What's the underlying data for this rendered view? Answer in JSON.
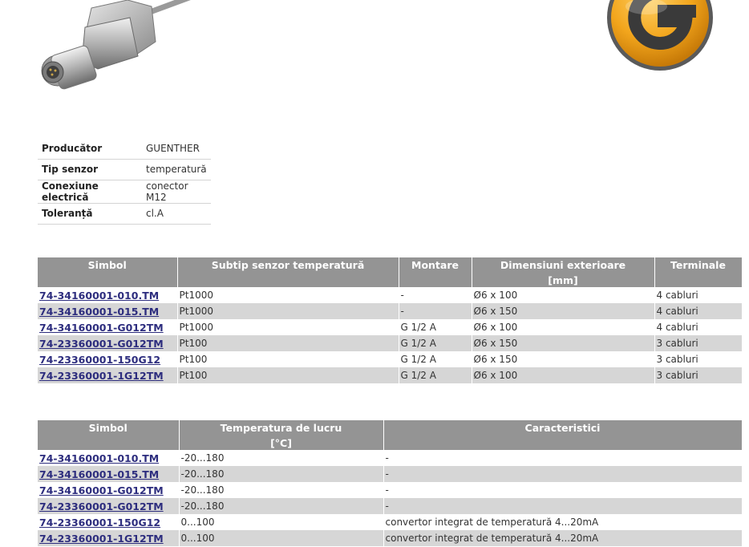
{
  "specs": [
    {
      "label": "Producător",
      "value": "GUENTHER"
    },
    {
      "label": "Tip senzor",
      "value": "temperatură"
    },
    {
      "label": "Conexiune electrică",
      "value": "conector M12"
    },
    {
      "label": "Toleranță",
      "value": "cl.A"
    }
  ],
  "table1": {
    "headers": [
      "Simbol",
      "Subtip senzor temperatură",
      "Montare",
      "Dimensiuni exterioare",
      "Terminale"
    ],
    "units": [
      "",
      "",
      "",
      "[mm]",
      ""
    ],
    "rows": [
      [
        "74-34160001-010.TM",
        "Pt1000",
        "-",
        "Ø6 x 100",
        "4 cabluri"
      ],
      [
        "74-34160001-015.TM",
        "Pt1000",
        "-",
        "Ø6 x 150",
        "4 cabluri"
      ],
      [
        "74-34160001-G012TM",
        "Pt1000",
        "G 1/2 A",
        "Ø6 x 100",
        "4 cabluri"
      ],
      [
        "74-23360001-G012TM",
        "Pt100",
        "G 1/2 A",
        "Ø6 x 150",
        "3 cabluri"
      ],
      [
        "74-23360001-150G12",
        "Pt100",
        "G 1/2 A",
        "Ø6 x 150",
        "3 cabluri"
      ],
      [
        "74-23360001-1G12TM",
        "Pt100",
        "G 1/2 A",
        "Ø6 x 100",
        "3 cabluri"
      ]
    ]
  },
  "table2": {
    "headers": [
      "Simbol",
      "Temperatura de lucru",
      "Caracteristici"
    ],
    "units": [
      "",
      "[°C]",
      ""
    ],
    "rows": [
      [
        "74-34160001-010.TM",
        "-20...180",
        "-"
      ],
      [
        "74-34160001-015.TM",
        "-20...180",
        "-"
      ],
      [
        "74-34160001-G012TM",
        "-20...180",
        "-"
      ],
      [
        "74-23360001-G012TM",
        "-20...180",
        "-"
      ],
      [
        "74-23360001-150G12",
        "0...100",
        "convertor integrat de temperatură 4...20mA"
      ],
      [
        "74-23360001-1G12TM",
        "0...100",
        "convertor integrat de temperatură 4...20mA"
      ]
    ]
  },
  "colors": {
    "header_bg": "#949494",
    "row_alt_bg": "#d6d6d6",
    "link": "#2d2d7e",
    "logo_orange": "#f2a51c"
  }
}
